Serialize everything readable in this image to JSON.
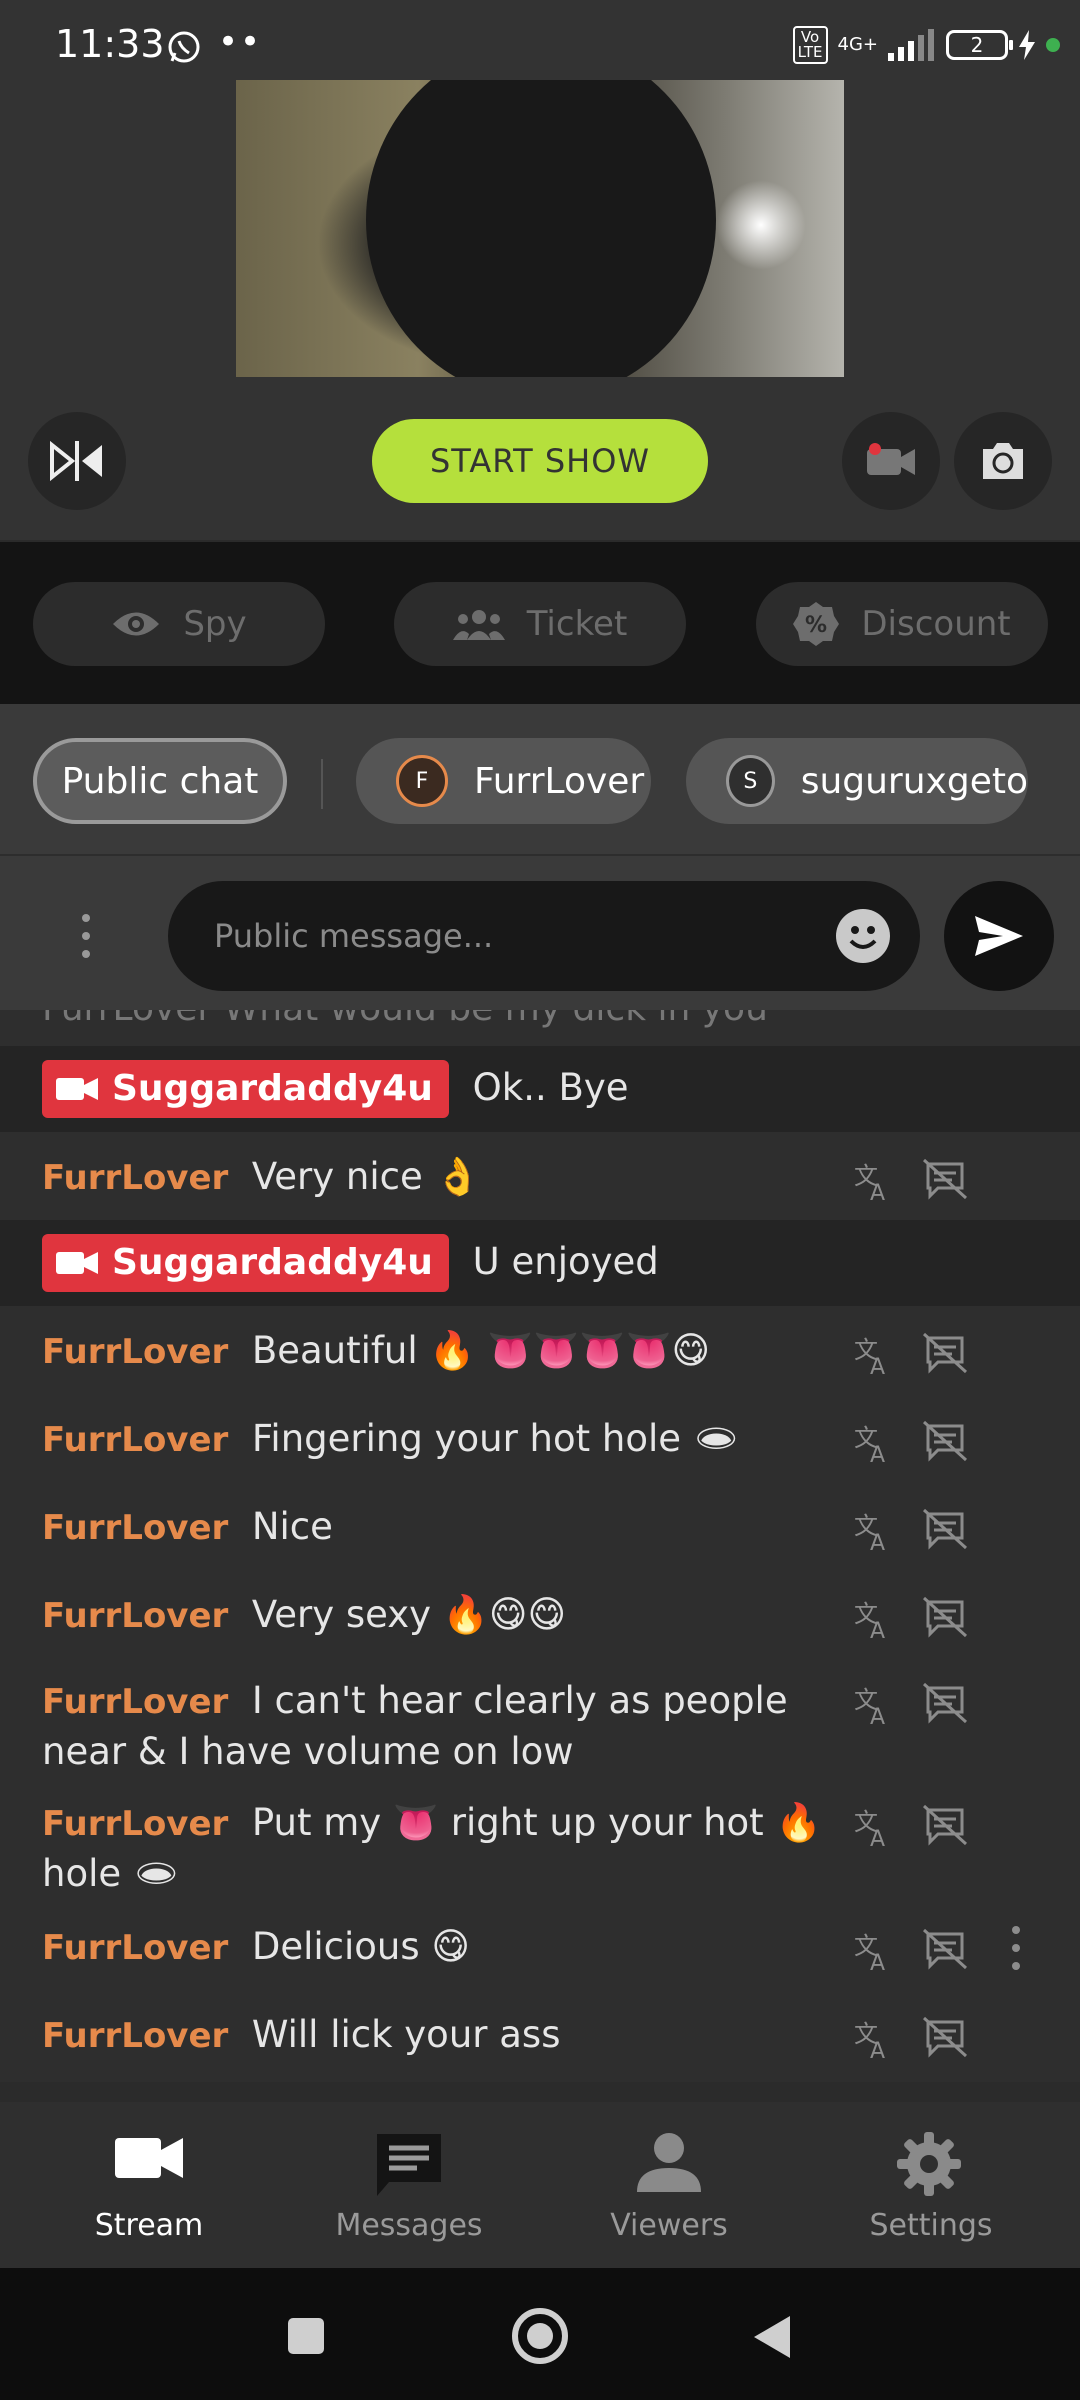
{
  "status_bar": {
    "time": "11:33",
    "volte": "Vo\nLTE",
    "network": "4G+",
    "battery": "2",
    "icons": [
      "whatsapp-icon",
      "more-dots-icon",
      "volte-icon",
      "signal-icon",
      "battery-icon",
      "charging-icon"
    ]
  },
  "stream": {
    "start_show_label": "START SHOW",
    "accent_color": "#b5e03c"
  },
  "pills": [
    {
      "label": "Spy",
      "icon": "eye-icon"
    },
    {
      "label": "Ticket",
      "icon": "group-icon"
    },
    {
      "label": "Discount",
      "icon": "discount-icon"
    }
  ],
  "tabs": {
    "public": "Public chat",
    "private": [
      {
        "initial": "F",
        "name": "FurrLover",
        "color": "#e68a4b"
      },
      {
        "initial": "S",
        "name": "suguruxgeto",
        "color": "#888888"
      }
    ]
  },
  "composer": {
    "placeholder": "Public message..."
  },
  "messages": {
    "cut_off_text": "FurrLover  What would be my dick in you",
    "items": [
      {
        "user": "Suggardaddy4u",
        "host": true,
        "text": "Ok.. Bye"
      },
      {
        "user": "FurrLover",
        "host": false,
        "text": "Very nice 👌"
      },
      {
        "user": "Suggardaddy4u",
        "host": true,
        "text": "U enjoyed"
      },
      {
        "user": "FurrLover",
        "host": false,
        "text": "Beautiful 🔥 👅👅👅👅😋"
      },
      {
        "user": "FurrLover",
        "host": false,
        "text": "Fingering your hot hole 🕳"
      },
      {
        "user": "FurrLover",
        "host": false,
        "text": "Nice"
      },
      {
        "user": "FurrLover",
        "host": false,
        "text": "Very sexy 🔥😋😋"
      },
      {
        "user": "FurrLover",
        "host": false,
        "text": "I can't hear clearly as people near & I have volume on low"
      },
      {
        "user": "FurrLover",
        "host": false,
        "text": "Put my 👅 right up your hot 🔥 hole 🕳"
      },
      {
        "user": "FurrLover",
        "host": false,
        "text": "Delicious 😋"
      },
      {
        "user": "FurrLover",
        "host": false,
        "text": "Will lick your ass"
      }
    ],
    "user_color": "#e68a4b",
    "host_badge_color": "#e0353e"
  },
  "bottom_nav": [
    {
      "label": "Stream",
      "icon": "videocam-icon",
      "active": true
    },
    {
      "label": "Messages",
      "icon": "chat-icon",
      "active": false
    },
    {
      "label": "Viewers",
      "icon": "person-icon",
      "active": false
    },
    {
      "label": "Settings",
      "icon": "gear-icon",
      "active": false
    }
  ]
}
